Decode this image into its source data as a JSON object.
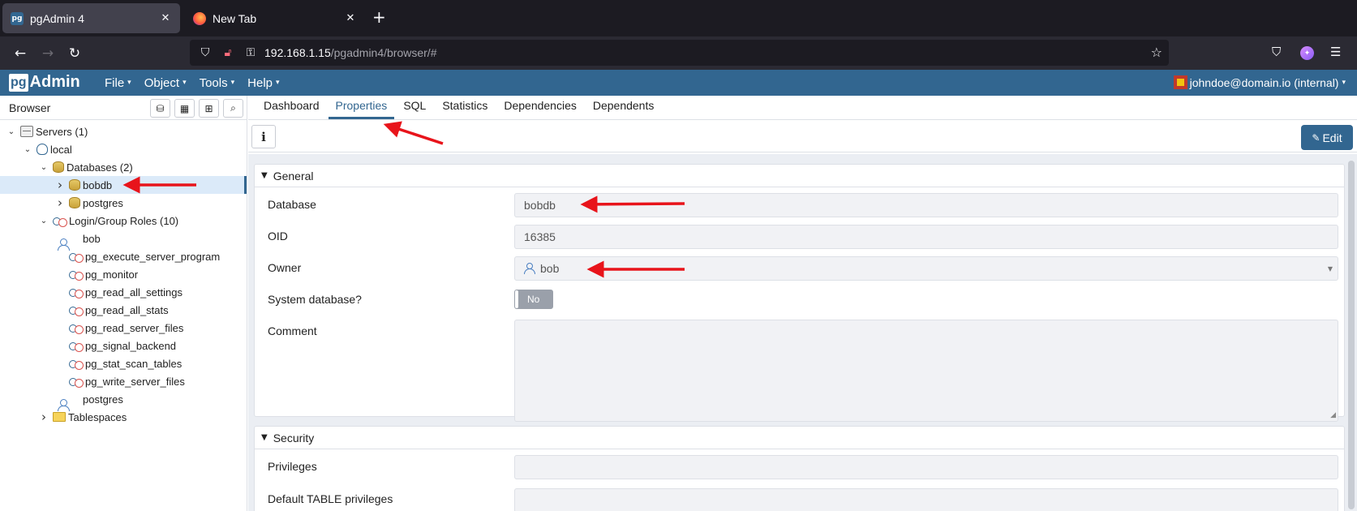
{
  "browser": {
    "tabs": [
      {
        "title": "pgAdmin 4",
        "favicon": "pg",
        "active": true
      },
      {
        "title": "New Tab",
        "favicon": "firefox",
        "active": false
      }
    ],
    "url_host": "192.168.1.15",
    "url_path": "/pgadmin4/browser/#"
  },
  "app": {
    "logo_pg": "pg",
    "logo_text": "Admin",
    "menu": [
      "File",
      "Object",
      "Tools",
      "Help"
    ],
    "user": "johndoe@domain.io (internal)"
  },
  "browser_panel": {
    "title": "Browser",
    "tree": [
      {
        "label": "Servers (1)",
        "level": 0,
        "icon": "server-icon",
        "toggle": "expanded"
      },
      {
        "label": "local",
        "level": 1,
        "icon": "elephant-icon",
        "toggle": "expanded"
      },
      {
        "label": "Databases (2)",
        "level": 2,
        "icon": "database-icon",
        "toggle": "expanded"
      },
      {
        "label": "bobdb",
        "level": 3,
        "icon": "database-icon",
        "toggle": "collapsed",
        "selected": true
      },
      {
        "label": "postgres",
        "level": 3,
        "icon": "database-icon",
        "toggle": "collapsed"
      },
      {
        "label": "Login/Group Roles (10)",
        "level": 2,
        "icon": "roles-icon",
        "toggle": "expanded"
      },
      {
        "label": "bob",
        "level": 3,
        "icon": "user-icon",
        "toggle": "none"
      },
      {
        "label": "pg_execute_server_program",
        "level": 3,
        "icon": "roles-icon",
        "toggle": "none"
      },
      {
        "label": "pg_monitor",
        "level": 3,
        "icon": "roles-icon",
        "toggle": "none"
      },
      {
        "label": "pg_read_all_settings",
        "level": 3,
        "icon": "roles-icon",
        "toggle": "none"
      },
      {
        "label": "pg_read_all_stats",
        "level": 3,
        "icon": "roles-icon",
        "toggle": "none"
      },
      {
        "label": "pg_read_server_files",
        "level": 3,
        "icon": "roles-icon",
        "toggle": "none"
      },
      {
        "label": "pg_signal_backend",
        "level": 3,
        "icon": "roles-icon",
        "toggle": "none"
      },
      {
        "label": "pg_stat_scan_tables",
        "level": 3,
        "icon": "roles-icon",
        "toggle": "none"
      },
      {
        "label": "pg_write_server_files",
        "level": 3,
        "icon": "roles-icon",
        "toggle": "none"
      },
      {
        "label": "postgres",
        "level": 3,
        "icon": "user-icon",
        "toggle": "none"
      },
      {
        "label": "Tablespaces",
        "level": 2,
        "icon": "folder-icon",
        "toggle": "collapsed"
      }
    ]
  },
  "object_tabs": [
    "Dashboard",
    "Properties",
    "SQL",
    "Statistics",
    "Dependencies",
    "Dependents"
  ],
  "active_tab": "Properties",
  "toolbar": {
    "edit_label": "Edit",
    "info_label": "i"
  },
  "general": {
    "title": "General",
    "database_label": "Database",
    "database_value": "bobdb",
    "oid_label": "OID",
    "oid_value": "16385",
    "owner_label": "Owner",
    "owner_value": "bob",
    "system_label": "System database?",
    "system_value": "No",
    "comment_label": "Comment",
    "comment_value": ""
  },
  "security": {
    "title": "Security",
    "privileges_label": "Privileges",
    "privileges_value": "",
    "default_table_label": "Default TABLE privileges"
  },
  "colors": {
    "header": "#326690",
    "arrow": "#e8141b",
    "selected_row": "#dbeaf9"
  }
}
